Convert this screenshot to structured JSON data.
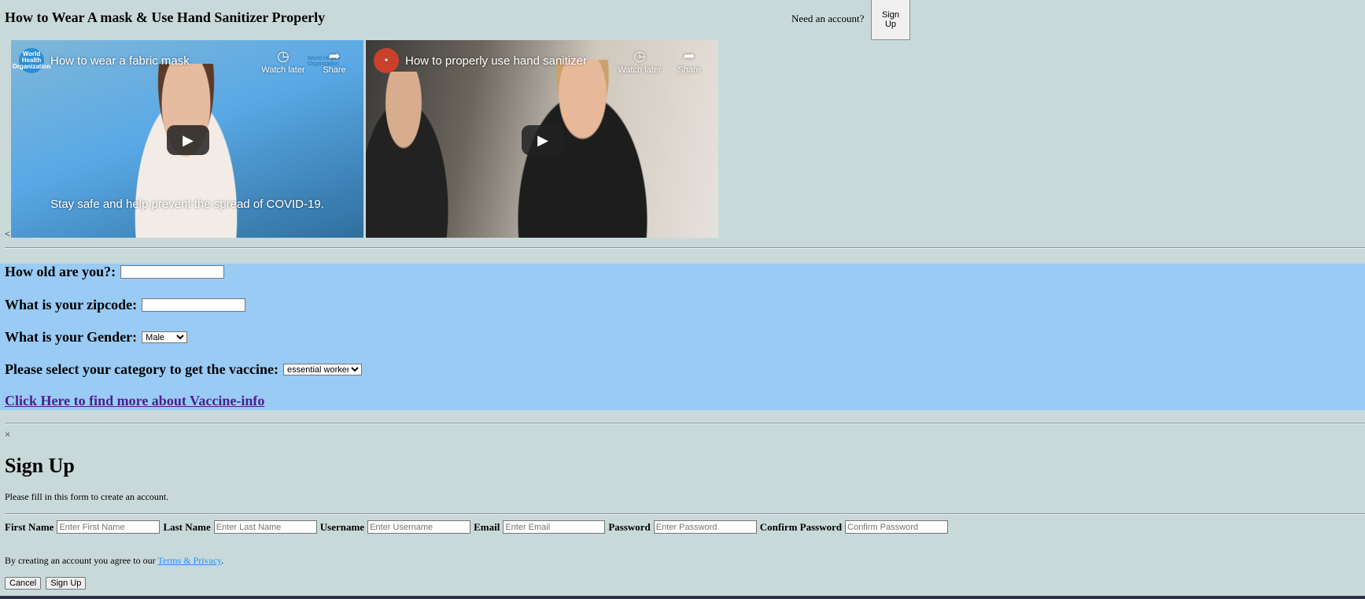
{
  "header": {
    "title": "How to Wear A mask & Use Hand Sanitizer Properly",
    "need_account": "Need an account?",
    "signup_button": "Sign Up"
  },
  "videos": [
    {
      "channel_logo": "who-logo",
      "logo_text": "World Health Organization",
      "title": "How to wear a fabric mask",
      "watch_later": "Watch later",
      "share": "Share",
      "caption": "Stay safe and help prevent the spread of COVID-19.",
      "watermark": "World Health Organization"
    },
    {
      "channel_logo": "uh-logo",
      "title": "How to properly use hand sanitizer",
      "watch_later": "Watch later",
      "share": "Share"
    }
  ],
  "stray_text": "<",
  "form": {
    "age_label": "How old are you?:",
    "age_value": "",
    "zip_label": "What is your zipcode:",
    "zip_value": "",
    "gender_label": "What is your Gender:",
    "gender_selected": "Male",
    "category_label": "Please select your category to get the vaccine:",
    "category_selected": "essential worker",
    "link_text": "Click Here to find more about Vaccine-info",
    "panel_color": "#99cbf4"
  },
  "signup": {
    "close": "×",
    "heading": "Sign Up",
    "subtitle": "Please fill in this form to create an account.",
    "fields": [
      {
        "label": "First Name",
        "placeholder": "Enter First Name"
      },
      {
        "label": "Last Name",
        "placeholder": "Enter Last Name"
      },
      {
        "label": "Username",
        "placeholder": "Enter Username"
      },
      {
        "label": "Email",
        "placeholder": "Enter Email"
      },
      {
        "label": "Password",
        "placeholder": "Enter Password"
      },
      {
        "label": "Confirm Password",
        "placeholder": "Confirm Password"
      }
    ],
    "terms_prefix": "By creating an account you agree to our ",
    "terms_link": "Terms & Privacy",
    "terms_suffix": ".",
    "cancel_button": "Cancel",
    "submit_button": "Sign Up"
  },
  "colors": {
    "page_background": "#c9d9d9",
    "link_visited": "#551a8b",
    "terms_link": "#1e90ff"
  }
}
